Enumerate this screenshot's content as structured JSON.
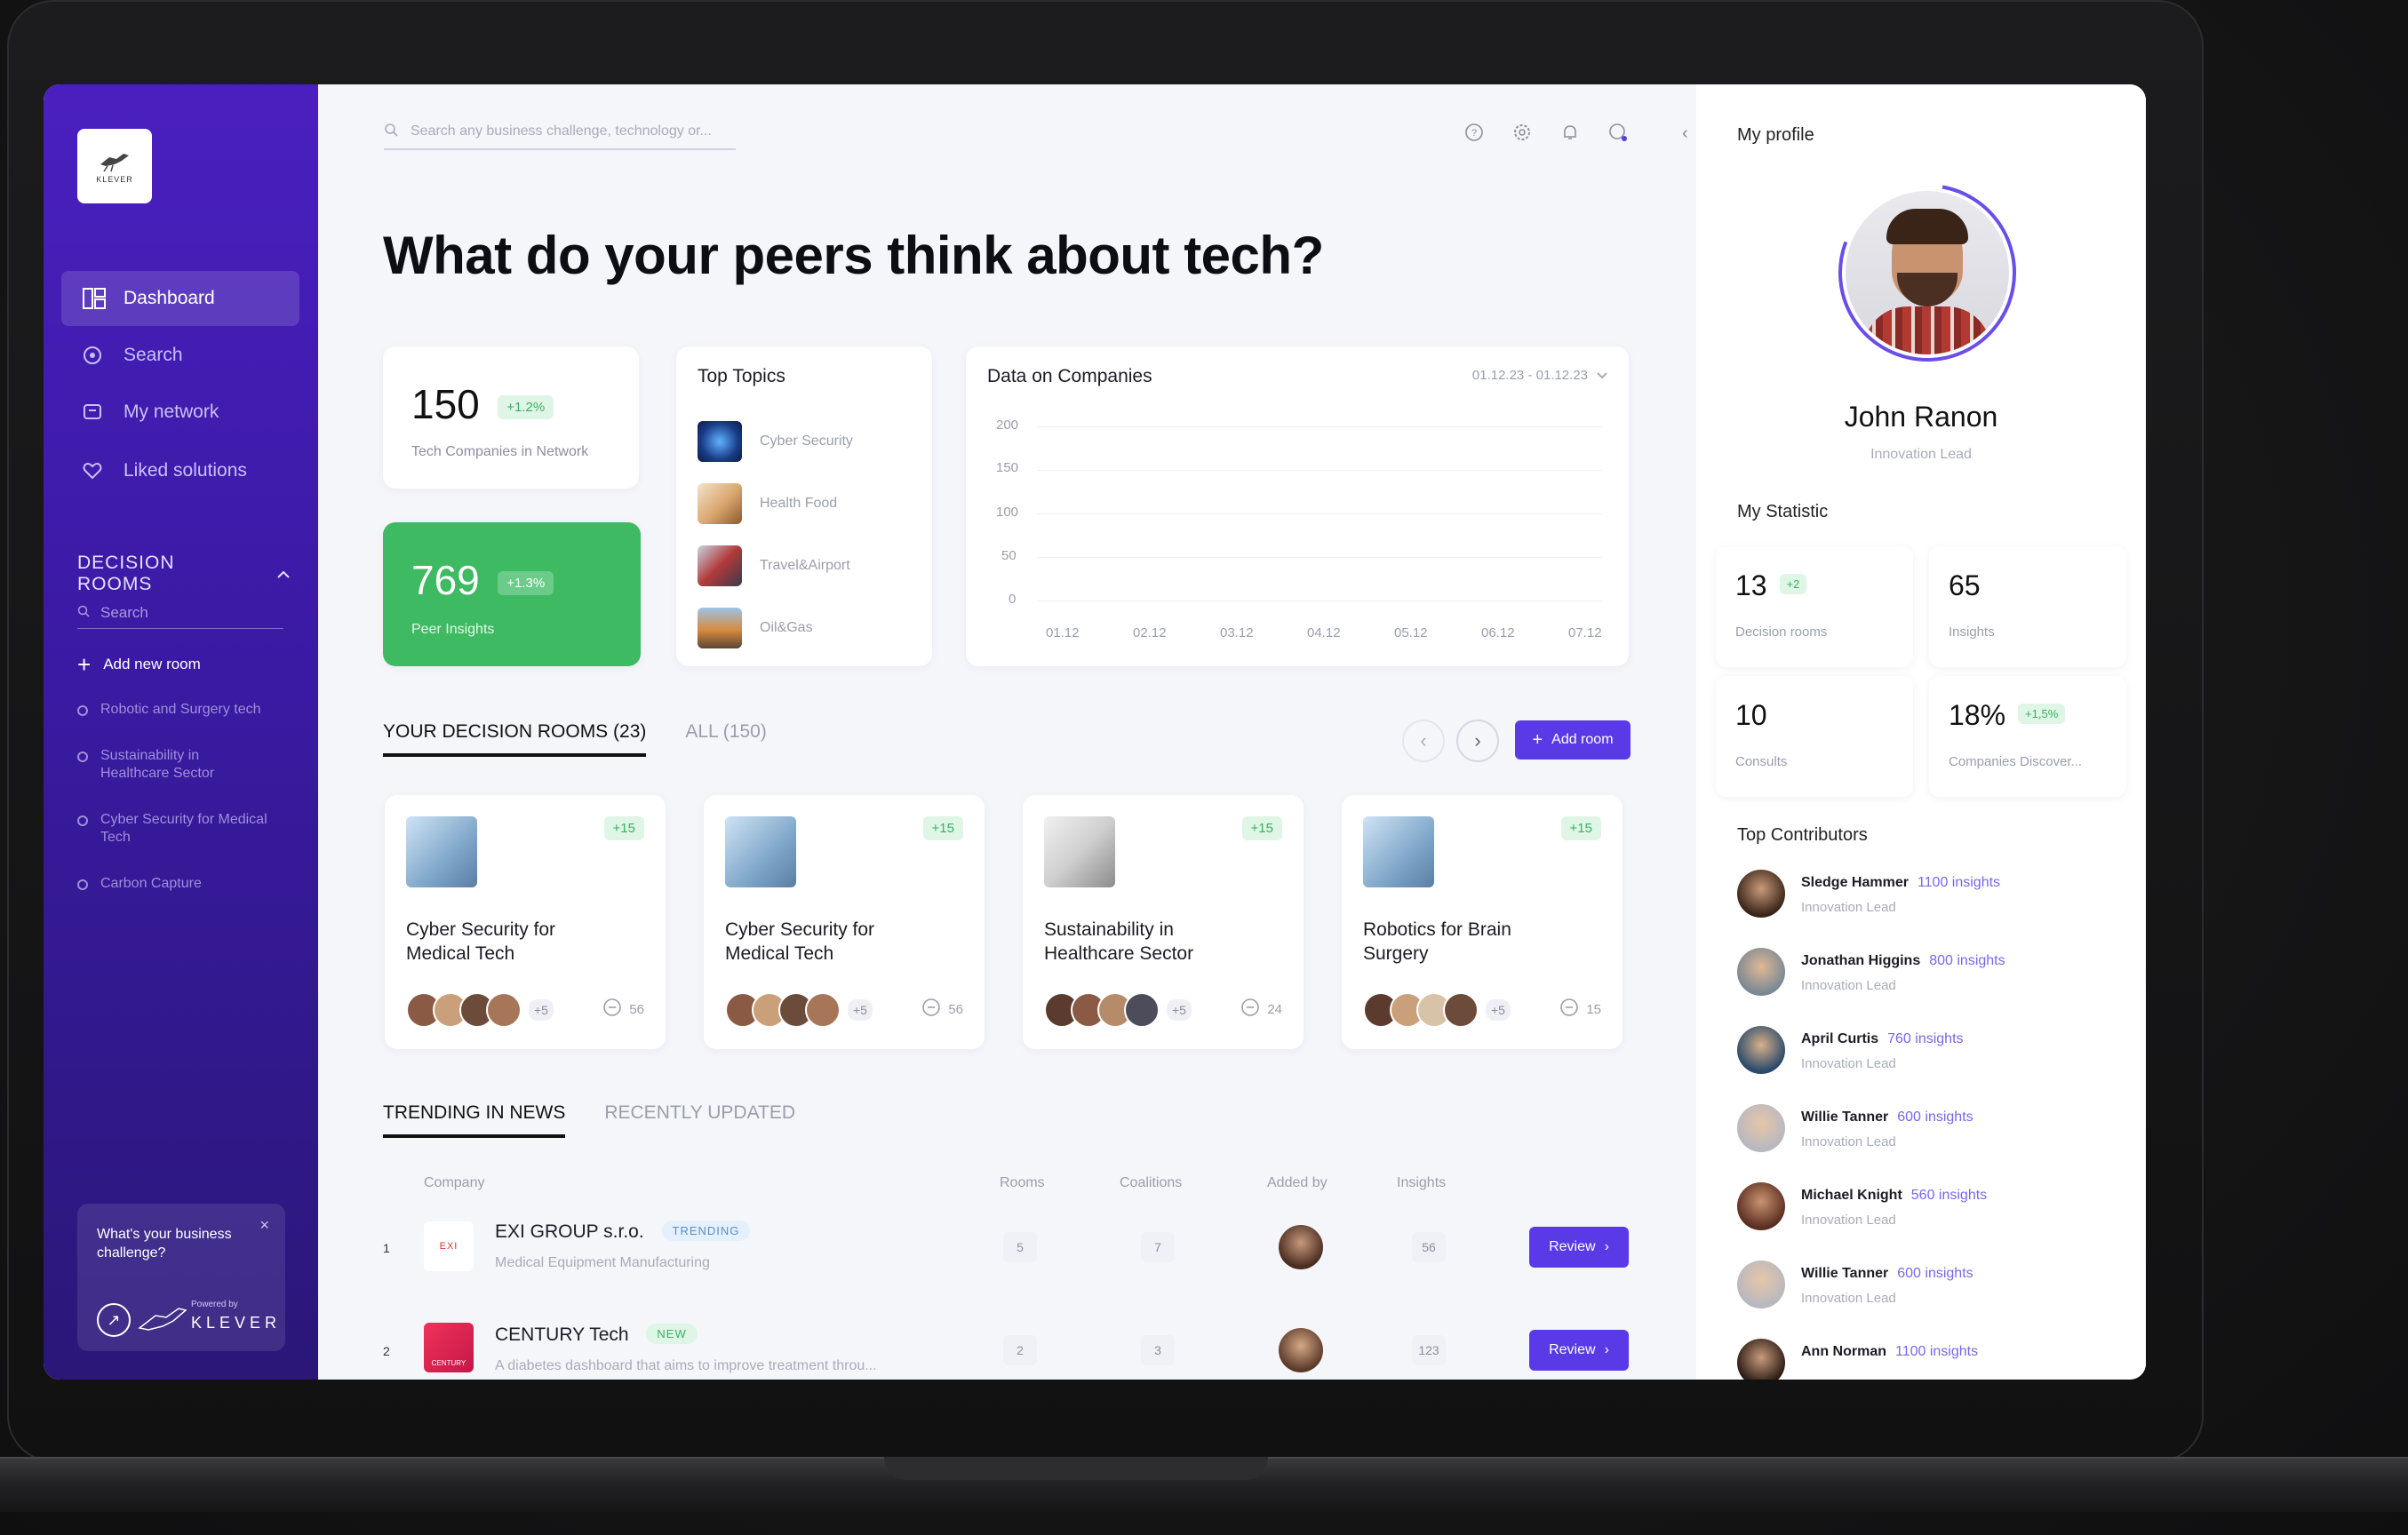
{
  "sidebar": {
    "logo_text": "KLEVER",
    "nav": [
      {
        "label": "Dashboard",
        "icon": "dashboard-icon"
      },
      {
        "label": "Search",
        "icon": "search-icon"
      },
      {
        "label": "My network",
        "icon": "network-icon"
      },
      {
        "label": "Liked solutions",
        "icon": "heart-icon"
      }
    ],
    "rooms_title": "DECISION ROOMS",
    "search_placeholder": "Search",
    "add_room": "Add new room",
    "rooms": [
      "Robotic and Surgery tech",
      "Sustainability in Healthcare Sector",
      "Cyber Security for Medical Tech",
      "Carbon Capture"
    ],
    "challenge": {
      "question": "What's your business challenge?",
      "powered_by": "Powered by",
      "brand": "KLEVER"
    }
  },
  "header": {
    "search_placeholder": "Search any business challenge, technology or...",
    "icons": [
      "help-icon",
      "settings-icon",
      "bell-icon",
      "chat-icon"
    ]
  },
  "headline": "What do your peers think about tech?",
  "stats": {
    "companies": {
      "value": "150",
      "change": "+1.2%",
      "label": "Tech Companies in Network"
    },
    "insights": {
      "value": "769",
      "change": "+1.3%",
      "label": "Peer Insights"
    }
  },
  "top_topics": {
    "title": "Top Topics",
    "items": [
      "Cyber Security",
      "Health Food",
      "Travel&Airport",
      "Oil&Gas"
    ]
  },
  "companies_chart": {
    "title": "Data on Companies",
    "date_range": "01.12.23 - 01.12.23",
    "y_ticks": [
      "200",
      "150",
      "100",
      "50",
      "0"
    ],
    "x_ticks": [
      "01.12",
      "02.12",
      "03.12",
      "04.12",
      "05.12",
      "06.12",
      "07.12"
    ]
  },
  "room_tabs": {
    "active": "YOUR DECISION ROOMS (23)",
    "inactive": "ALL (150)",
    "add_button": "Add room"
  },
  "room_cards": [
    {
      "title": "Cyber Security for Medical Tech",
      "badge": "+15",
      "more": "+5",
      "comments": "56"
    },
    {
      "title": "Cyber Security for Medical Tech",
      "badge": "+15",
      "more": "+5",
      "comments": "56"
    },
    {
      "title": "Sustainability in Healthcare Sector",
      "badge": "+15",
      "more": "+5",
      "comments": "24"
    },
    {
      "title": "Robotics for Brain Surgery",
      "badge": "+15",
      "more": "+5",
      "comments": "15"
    }
  ],
  "news_tabs": {
    "active": "TRENDING IN NEWS",
    "inactive": "RECENTLY UPDATED"
  },
  "table": {
    "headers": [
      "Company",
      "Rooms",
      "Coalitions",
      "Added by",
      "Insights"
    ],
    "rows": [
      {
        "num": "1",
        "name": "EXI GROUP s.r.o.",
        "badge": "TRENDING",
        "desc": "Medical Equipment Manufacturing",
        "rooms": "5",
        "coalitions": "7",
        "insights": "56",
        "action": "Review",
        "logo_text": "EXI"
      },
      {
        "num": "2",
        "name": "CENTURY Tech",
        "badge": "NEW",
        "desc": "A diabetes dashboard that aims to improve treatment throu...",
        "rooms": "2",
        "coalitions": "3",
        "insights": "123",
        "action": "Review",
        "logo_text": "CENTURY"
      }
    ]
  },
  "profile": {
    "title": "My profile",
    "name": "John Ranon",
    "role": "Innovation Lead",
    "statistic_title": "My Statistic",
    "stats": [
      {
        "value": "13",
        "change": "+2",
        "label": "Decision rooms"
      },
      {
        "value": "65",
        "change": "",
        "label": "Insights"
      },
      {
        "value": "10",
        "change": "",
        "label": "Consults"
      },
      {
        "value": "18%",
        "change": "+1,5%",
        "label": "Companies Discover..."
      }
    ],
    "contributors_title": "Top Contributors",
    "contributors": [
      {
        "name": "Sledge Hammer",
        "insights": "1100 insights",
        "role": "Innovation Lead"
      },
      {
        "name": "Jonathan Higgins",
        "insights": "800 insights",
        "role": "Innovation Lead"
      },
      {
        "name": "April Curtis",
        "insights": "760 insights",
        "role": "Innovation Lead"
      },
      {
        "name": "Willie Tanner",
        "insights": "600 insights",
        "role": "Innovation Lead"
      },
      {
        "name": "Michael Knight",
        "insights": "560 insights",
        "role": "Innovation Lead"
      },
      {
        "name": "Willie Tanner",
        "insights": "600 insights",
        "role": "Innovation Lead"
      },
      {
        "name": "Ann Norman",
        "insights": "1100 insights",
        "role": ""
      }
    ]
  },
  "colors": {
    "accent": "#5a3ae6",
    "green": "#37b163",
    "sidebar_top": "#4a1fbf",
    "sidebar_bottom": "#2a1778"
  }
}
